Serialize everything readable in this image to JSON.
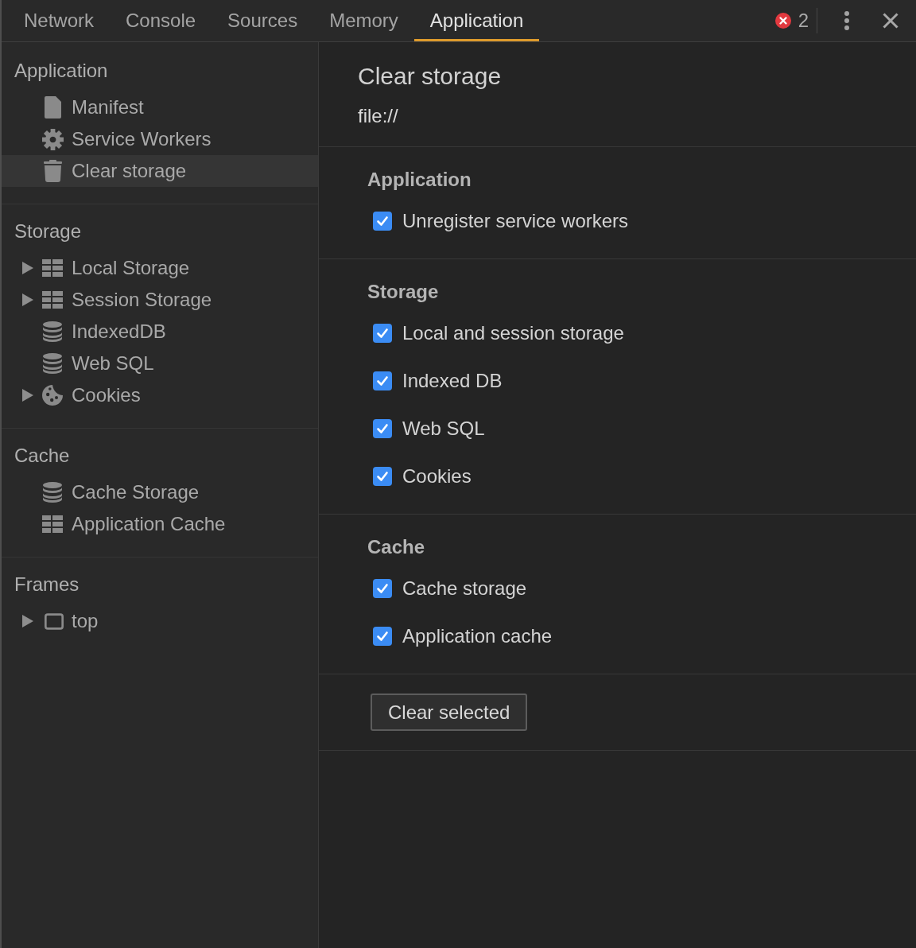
{
  "tabs": [
    {
      "label": "Network",
      "selected": false
    },
    {
      "label": "Console",
      "selected": false
    },
    {
      "label": "Sources",
      "selected": false
    },
    {
      "label": "Memory",
      "selected": false
    },
    {
      "label": "Application",
      "selected": true
    }
  ],
  "toolbar": {
    "error_count": "2"
  },
  "sidebar": {
    "sections": [
      {
        "heading": "Application",
        "items": [
          {
            "label": "Manifest",
            "kind": "file",
            "expandable": false,
            "selected": false
          },
          {
            "label": "Service Workers",
            "kind": "gear",
            "expandable": false,
            "selected": false
          },
          {
            "label": "Clear storage",
            "kind": "trash",
            "expandable": false,
            "selected": true
          }
        ]
      },
      {
        "heading": "Storage",
        "items": [
          {
            "label": "Local Storage",
            "kind": "table",
            "expandable": true,
            "expanded": false,
            "selected": false
          },
          {
            "label": "Session Storage",
            "kind": "table",
            "expandable": true,
            "expanded": false,
            "selected": false
          },
          {
            "label": "IndexedDB",
            "kind": "database",
            "expandable": false,
            "selected": false
          },
          {
            "label": "Web SQL",
            "kind": "database",
            "expandable": false,
            "selected": false
          },
          {
            "label": "Cookies",
            "kind": "cookie",
            "expandable": true,
            "expanded": false,
            "selected": false
          }
        ]
      },
      {
        "heading": "Cache",
        "items": [
          {
            "label": "Cache Storage",
            "kind": "database",
            "expandable": false,
            "selected": false
          },
          {
            "label": "Application Cache",
            "kind": "table",
            "expandable": false,
            "selected": false
          }
        ]
      },
      {
        "heading": "Frames",
        "items": [
          {
            "label": "top",
            "kind": "frame",
            "expandable": true,
            "expanded": false,
            "selected": false
          }
        ]
      }
    ]
  },
  "main": {
    "title": "Clear storage",
    "origin": "file://",
    "sections": [
      {
        "heading": "Application",
        "options": [
          {
            "label": "Unregister service workers",
            "checked": true
          }
        ]
      },
      {
        "heading": "Storage",
        "options": [
          {
            "label": "Local and session storage",
            "checked": true
          },
          {
            "label": "Indexed DB",
            "checked": true
          },
          {
            "label": "Web SQL",
            "checked": true
          },
          {
            "label": "Cookies",
            "checked": true
          }
        ]
      },
      {
        "heading": "Cache",
        "options": [
          {
            "label": "Cache storage",
            "checked": true
          },
          {
            "label": "Application cache",
            "checked": true
          }
        ]
      }
    ],
    "button": "Clear selected"
  }
}
